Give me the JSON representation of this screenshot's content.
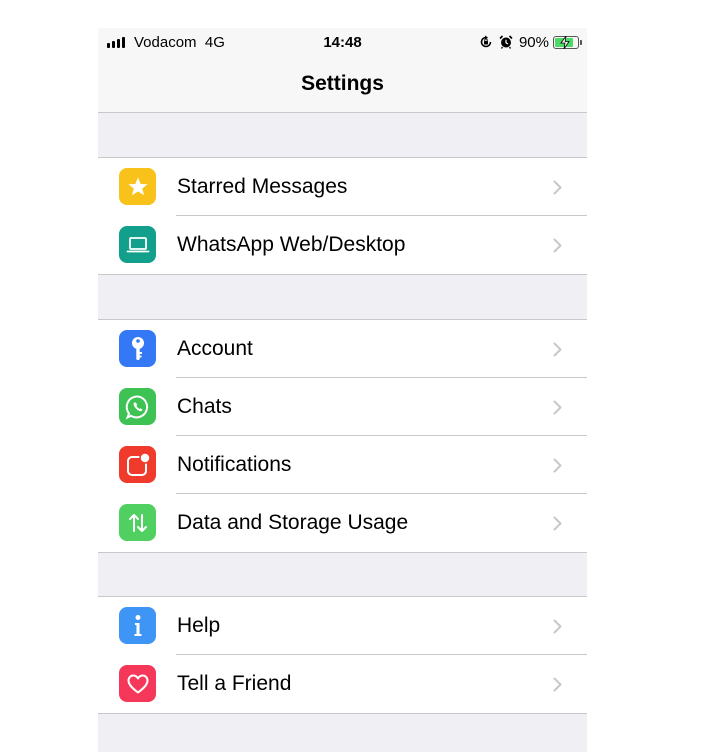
{
  "status_bar": {
    "carrier": "Vodacom  4G",
    "time": "14:48",
    "battery_percent": "90%",
    "battery_level": 0.9,
    "icons": [
      "signal-icon",
      "orientation-lock-icon",
      "alarm-icon",
      "battery-charging-icon"
    ]
  },
  "nav": {
    "title": "Settings"
  },
  "groups": [
    {
      "items": [
        {
          "label": "Starred Messages",
          "icon": "star-icon",
          "color": "#f8c21a"
        },
        {
          "label": "WhatsApp Web/Desktop",
          "icon": "laptop-icon",
          "color": "#12a08d"
        }
      ]
    },
    {
      "items": [
        {
          "label": "Account",
          "icon": "key-icon",
          "color": "#3478f6"
        },
        {
          "label": "Chats",
          "icon": "whatsapp-icon",
          "color": "#3fc254"
        },
        {
          "label": "Notifications",
          "icon": "notification-badge-icon",
          "color": "#f03a2c"
        },
        {
          "label": "Data and Storage Usage",
          "icon": "up-down-arrows-icon",
          "color": "#4fd061"
        }
      ]
    },
    {
      "items": [
        {
          "label": "Help",
          "icon": "info-icon",
          "color": "#3f95f6"
        },
        {
          "label": "Tell a Friend",
          "icon": "heart-icon",
          "color": "#f5385a"
        }
      ]
    }
  ]
}
